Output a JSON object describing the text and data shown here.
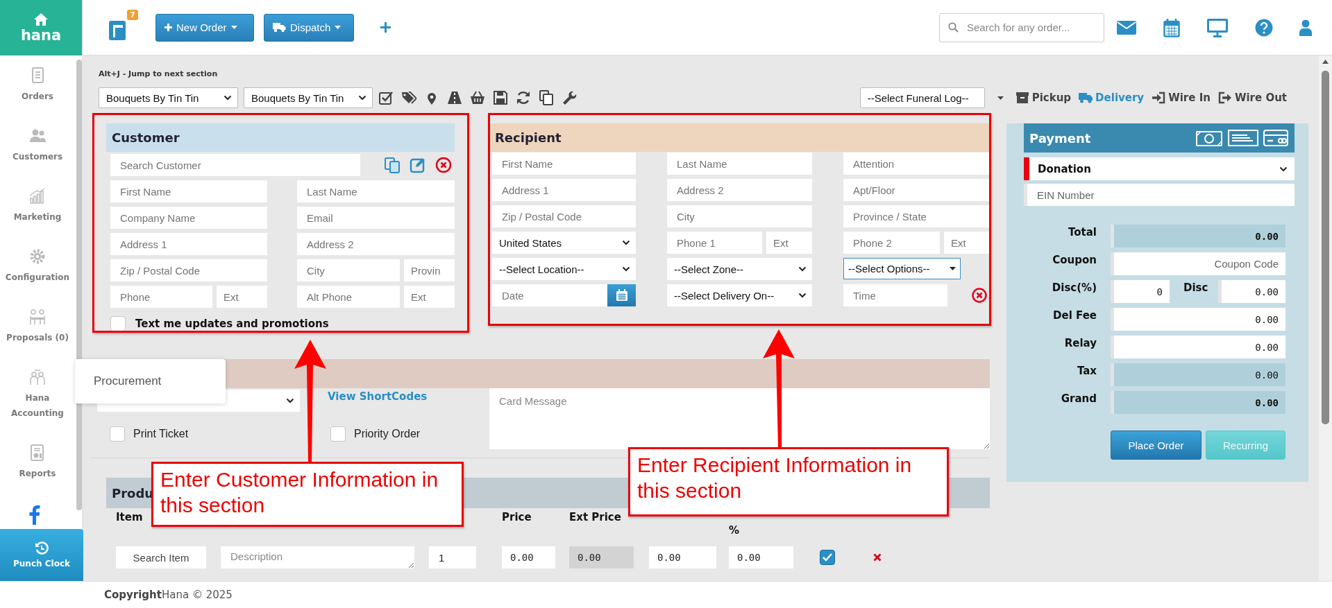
{
  "sidebar": {
    "logo": "hana",
    "items": [
      {
        "label": "Orders"
      },
      {
        "label": "Customers"
      },
      {
        "label": "Marketing"
      },
      {
        "label": "Configuration"
      },
      {
        "label": "Proposals (0)"
      },
      {
        "label": "Hana Accounting"
      },
      {
        "label": "Reports"
      }
    ],
    "punch_clock": "Punch Clock",
    "flyout": [
      {
        "label": "Procurement"
      }
    ]
  },
  "topbar": {
    "cart_count": "7",
    "buttons": [
      {
        "label": "New Order"
      },
      {
        "label": "Dispatch"
      }
    ],
    "search_placeholder": "Search for any order..."
  },
  "hint": "Alt+J - Jump to next section",
  "toolbar": {
    "selects": [
      {
        "value": "Bouquets By Tin Tin"
      },
      {
        "value": "Bouquets By Tin Tin"
      }
    ],
    "funeral_select": "--Select Funeral Log--",
    "order_types": [
      {
        "label": "Pickup",
        "selected": false
      },
      {
        "label": "Delivery",
        "selected": true
      },
      {
        "label": "Wire In",
        "selected": false
      },
      {
        "label": "Wire Out",
        "selected": false
      }
    ]
  },
  "customer": {
    "title": "Customer",
    "search_placeholder": "Search Customer",
    "rows": [
      [
        [
          {
            "kind": "input",
            "placeholder": "First Name"
          }
        ],
        [
          {
            "kind": "input",
            "placeholder": "Last Name"
          }
        ]
      ],
      [
        [
          {
            "kind": "input",
            "placeholder": "Company Name"
          }
        ],
        [
          {
            "kind": "input",
            "placeholder": "Email"
          }
        ]
      ],
      [
        [
          {
            "kind": "input",
            "placeholder": "Address 1"
          }
        ],
        [
          {
            "kind": "input",
            "placeholder": "Address 2"
          }
        ]
      ],
      [
        [
          {
            "kind": "input",
            "placeholder": "Zip / Postal Code"
          }
        ],
        [
          {
            "kind": "input",
            "placeholder": "City"
          },
          {
            "kind": "ext",
            "placeholder": "Provin"
          }
        ]
      ],
      [
        [
          {
            "kind": "input",
            "placeholder": "Phone"
          },
          {
            "kind": "ext",
            "placeholder": "Ext"
          }
        ],
        [
          {
            "kind": "input",
            "placeholder": "Alt Phone"
          },
          {
            "kind": "ext",
            "placeholder": "Ext"
          }
        ]
      ]
    ],
    "text_updates": {
      "label": "Text me updates and promotions",
      "checked": false
    }
  },
  "recipient": {
    "title": "Recipient",
    "rows": [
      [
        [
          {
            "kind": "input",
            "placeholder": "First Name"
          }
        ],
        [
          {
            "kind": "input",
            "placeholder": "Last Name"
          }
        ],
        [
          {
            "kind": "input",
            "placeholder": "Attention"
          }
        ]
      ],
      [
        [
          {
            "kind": "input",
            "placeholder": "Address 1"
          }
        ],
        [
          {
            "kind": "input",
            "placeholder": "Address 2"
          }
        ],
        [
          {
            "kind": "input",
            "placeholder": "Apt/Floor"
          }
        ]
      ],
      [
        [
          {
            "kind": "input",
            "placeholder": "Zip / Postal Code"
          }
        ],
        [
          {
            "kind": "input",
            "placeholder": "City"
          }
        ],
        [
          {
            "kind": "input",
            "placeholder": "Province / State"
          }
        ]
      ],
      [
        [
          {
            "kind": "select",
            "value": "United States"
          }
        ],
        [
          {
            "kind": "input",
            "placeholder": "Phone 1"
          },
          {
            "kind": "ext",
            "placeholder": "Ext"
          }
        ],
        [
          {
            "kind": "input",
            "placeholder": "Phone 2"
          },
          {
            "kind": "ext",
            "placeholder": "Ext"
          }
        ]
      ],
      [
        [
          {
            "kind": "select",
            "value": "--Select Location--"
          }
        ],
        [
          {
            "kind": "select",
            "value": "--Select Zone--"
          }
        ],
        [
          {
            "kind": "dropdown",
            "value": "--Select Options--"
          }
        ]
      ],
      [
        [
          {
            "kind": "date",
            "placeholder": "Date"
          }
        ],
        [
          {
            "kind": "select",
            "value": "--Select Delivery On--"
          }
        ],
        [
          {
            "kind": "time",
            "placeholder": "Time"
          }
        ]
      ]
    ]
  },
  "order_options": {
    "shortcodes_link": "View ShortCodes",
    "card_message_placeholder": "Card Message",
    "checkboxes": [
      {
        "label": "Print Ticket",
        "checked": false
      },
      {
        "label": "Priority Order",
        "checked": false
      }
    ]
  },
  "products": {
    "title": "Produ",
    "columns": [
      {
        "label": "Item"
      },
      {
        "label": "Price"
      },
      {
        "label": "Ext Price"
      },
      {
        "label": "%"
      }
    ],
    "rows": [
      {
        "item_button": "Search Item",
        "description_placeholder": "Description",
        "qty": "1",
        "price": "0.00",
        "ext_price": "0.00",
        "discount": "0.00",
        "discount_pct": "0.00",
        "taxable": true
      }
    ]
  },
  "payment": {
    "title": "Payment",
    "method": "Donation",
    "ein_placeholder": "EIN Number",
    "rows": [
      {
        "label": "Total",
        "kind": "total",
        "value": "0.00"
      },
      {
        "label": "Coupon",
        "kind": "input",
        "placeholder": "Coupon Code"
      },
      {
        "label": "Disc(%)",
        "kind": "pair",
        "value": "0",
        "label2": "Disc",
        "value2": "0.00"
      },
      {
        "label": "Del Fee",
        "kind": "input",
        "value": "0.00"
      },
      {
        "label": "Relay",
        "kind": "input",
        "value": "0.00"
      },
      {
        "label": "Tax",
        "kind": "readonly",
        "value": "0.00"
      },
      {
        "label": "Grand",
        "kind": "total",
        "value": "0.00"
      }
    ],
    "buttons": [
      {
        "label": "Place Order",
        "kind": "primary"
      },
      {
        "label": "Recurring",
        "kind": "secondary"
      }
    ]
  },
  "callouts": [
    {
      "text": "Enter Customer Information in this section"
    },
    {
      "text": "Enter Recipient Information in this section"
    }
  ],
  "footer": "**Copyright**Hana © 2025"
}
